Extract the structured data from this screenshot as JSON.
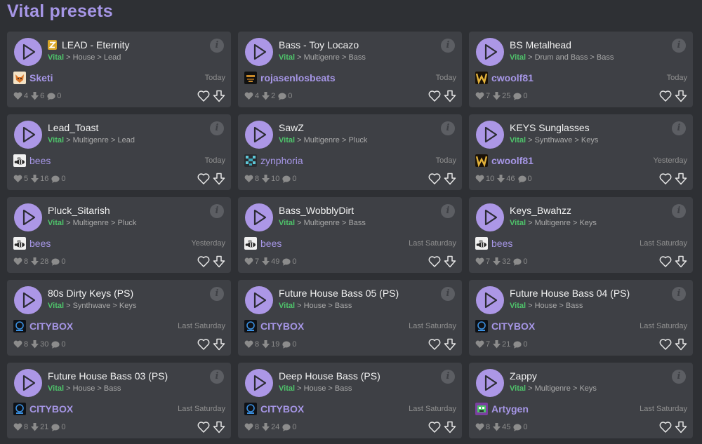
{
  "page": {
    "title": "Vital presets"
  },
  "colors": {
    "accent": "#a696e6",
    "synth": "#4fc46b",
    "card": "#3e4045",
    "background": "#2e3034"
  },
  "info_label": "i",
  "presets": [
    {
      "name": "LEAD - Eternity",
      "icon": "zzz-emoji-icon",
      "synth": "Vital",
      "path": " > House > Lead",
      "author": "Sketi",
      "avatar": "fox",
      "author_bold": true,
      "date": "Today",
      "likes": "4",
      "downloads": "6",
      "comments": "0"
    },
    {
      "name": "Bass - Toy Locazo",
      "synth": "Vital",
      "path": " > Multigenre > Bass",
      "author": "rojasenlosbeats",
      "avatar": "rojas",
      "author_bold": true,
      "date": "Today",
      "likes": "4",
      "downloads": "2",
      "comments": "0"
    },
    {
      "name": "BS Metalhead",
      "synth": "Vital",
      "path": " > Drum and Bass > Bass",
      "author": "cwoolf81",
      "avatar": "w",
      "author_bold": true,
      "date": "Today",
      "likes": "7",
      "downloads": "25",
      "comments": "0"
    },
    {
      "name": "Lead_Toast",
      "synth": "Vital",
      "path": " > Multigenre > Lead",
      "author": "bees",
      "avatar": "bee",
      "author_bold": false,
      "date": "Today",
      "likes": "5",
      "downloads": "16",
      "comments": "0"
    },
    {
      "name": "SawZ",
      "synth": "Vital",
      "path": " > Multigenre > Pluck",
      "author": "zynphoria",
      "avatar": "pixel",
      "author_bold": false,
      "date": "Today",
      "likes": "8",
      "downloads": "10",
      "comments": "0"
    },
    {
      "name": "KEYS Sunglasses",
      "synth": "Vital",
      "path": " > Synthwave > Keys",
      "author": "cwoolf81",
      "avatar": "w",
      "author_bold": true,
      "date": "Yesterday",
      "likes": "10",
      "downloads": "46",
      "comments": "0"
    },
    {
      "name": "Pluck_Sitarish",
      "synth": "Vital",
      "path": " > Multigenre > Pluck",
      "author": "bees",
      "avatar": "bee",
      "author_bold": false,
      "date": "Yesterday",
      "likes": "8",
      "downloads": "28",
      "comments": "0"
    },
    {
      "name": "Bass_WobblyDirt",
      "synth": "Vital",
      "path": " > Multigenre > Bass",
      "author": "bees",
      "avatar": "bee",
      "author_bold": false,
      "date": "Last Saturday",
      "likes": "7",
      "downloads": "49",
      "comments": "0"
    },
    {
      "name": "Keys_Bwahzz",
      "synth": "Vital",
      "path": " > Multigenre > Keys",
      "author": "bees",
      "avatar": "bee",
      "author_bold": false,
      "date": "Last Saturday",
      "likes": "7",
      "downloads": "32",
      "comments": "0"
    },
    {
      "name": "80s Dirty Keys (PS)",
      "synth": "Vital",
      "path": " > Synthwave > Keys",
      "author": "CITYBOX",
      "avatar": "citybox",
      "author_bold": true,
      "date": "Last Saturday",
      "likes": "8",
      "downloads": "30",
      "comments": "0"
    },
    {
      "name": "Future House Bass 05 (PS)",
      "synth": "Vital",
      "path": " > House > Bass",
      "author": "CITYBOX",
      "avatar": "citybox",
      "author_bold": true,
      "date": "Last Saturday",
      "likes": "8",
      "downloads": "19",
      "comments": "0"
    },
    {
      "name": "Future House Bass 04 (PS)",
      "synth": "Vital",
      "path": " > House > Bass",
      "author": "CITYBOX",
      "avatar": "citybox",
      "author_bold": true,
      "date": "Last Saturday",
      "likes": "7",
      "downloads": "21",
      "comments": "0"
    },
    {
      "name": "Future House Bass 03 (PS)",
      "synth": "Vital",
      "path": " > House > Bass",
      "author": "CITYBOX",
      "avatar": "citybox",
      "author_bold": true,
      "date": "Last Saturday",
      "likes": "8",
      "downloads": "21",
      "comments": "0"
    },
    {
      "name": "Deep House Bass (PS)",
      "synth": "Vital",
      "path": " > House > Bass",
      "author": "CITYBOX",
      "avatar": "citybox",
      "author_bold": true,
      "date": "Last Saturday",
      "likes": "8",
      "downloads": "24",
      "comments": "0"
    },
    {
      "name": "Zappy",
      "synth": "Vital",
      "path": " > Multigenre > Keys",
      "author": "Artygen",
      "avatar": "artygen",
      "author_bold": true,
      "date": "Last Saturday",
      "likes": "8",
      "downloads": "45",
      "comments": "0"
    }
  ]
}
